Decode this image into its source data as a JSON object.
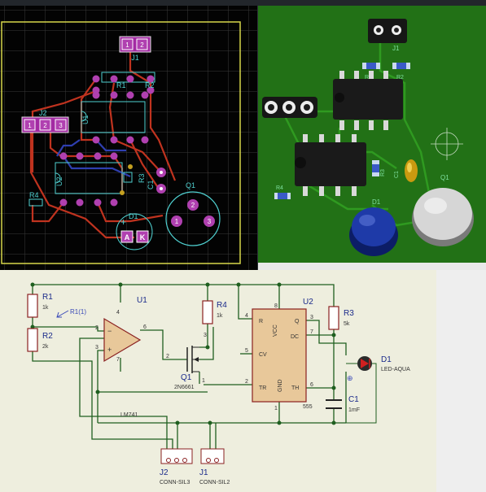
{
  "pcb": {
    "labels": {
      "j1": "J1",
      "j2": "J2",
      "r1": "R1",
      "r2": "R2",
      "u1": "U1",
      "u2": "U2",
      "r3": "R3",
      "c1": "C1",
      "r4": "R4",
      "d1": "D1",
      "q1": "Q1",
      "anode": "A",
      "cathode": "K",
      "plus": "+",
      "pin1": "1",
      "pin2": "2",
      "pin3": "3"
    }
  },
  "board3d": {
    "labels": {
      "j1": "J1",
      "r1": "R1",
      "r2": "R2",
      "r3": "R3",
      "c1": "C1",
      "r4": "R4",
      "d1": "D1",
      "q1": "Q1"
    }
  },
  "schematic": {
    "r1": {
      "ref": "R1",
      "value": "1k"
    },
    "r2": {
      "ref": "R2",
      "value": "2k"
    },
    "r4": {
      "ref": "R4",
      "value": "1k"
    },
    "r3": {
      "ref": "R3",
      "value": "5k"
    },
    "u1": {
      "ref": "U1",
      "value": "LM741"
    },
    "u2": {
      "ref": "U2",
      "value": "555"
    },
    "q1": {
      "ref": "Q1",
      "value": "2N6661"
    },
    "d1": {
      "ref": "D1",
      "value": "LED-AQUA"
    },
    "c1": {
      "ref": "C1",
      "value": "1mF"
    },
    "j1": {
      "ref": "J1",
      "value": "CONN-SIL2"
    },
    "j2": {
      "ref": "J2",
      "value": "CONN-SIL3"
    },
    "probe": "R1(1)",
    "u2_pins": {
      "r": "R",
      "vcc": "VCC",
      "q": "Q",
      "dc": "DC",
      "cv": "CV",
      "tr": "TR",
      "gnd": "GND",
      "th": "TH"
    },
    "pin_numbers": {
      "u1_in_minus": "2",
      "u1_in_plus": "3",
      "u1_v_plus": "4",
      "u1_out": "6",
      "u1_v_minus": "7",
      "q1_g": "2",
      "q1_d": "3",
      "q1_s": "1",
      "u2_r": "4",
      "u2_vcc": "8",
      "u2_q": "3",
      "u2_dc": "7",
      "u2_cv": "5",
      "u2_tr": "2",
      "u2_gnd": "1",
      "u2_th": "6"
    }
  }
}
